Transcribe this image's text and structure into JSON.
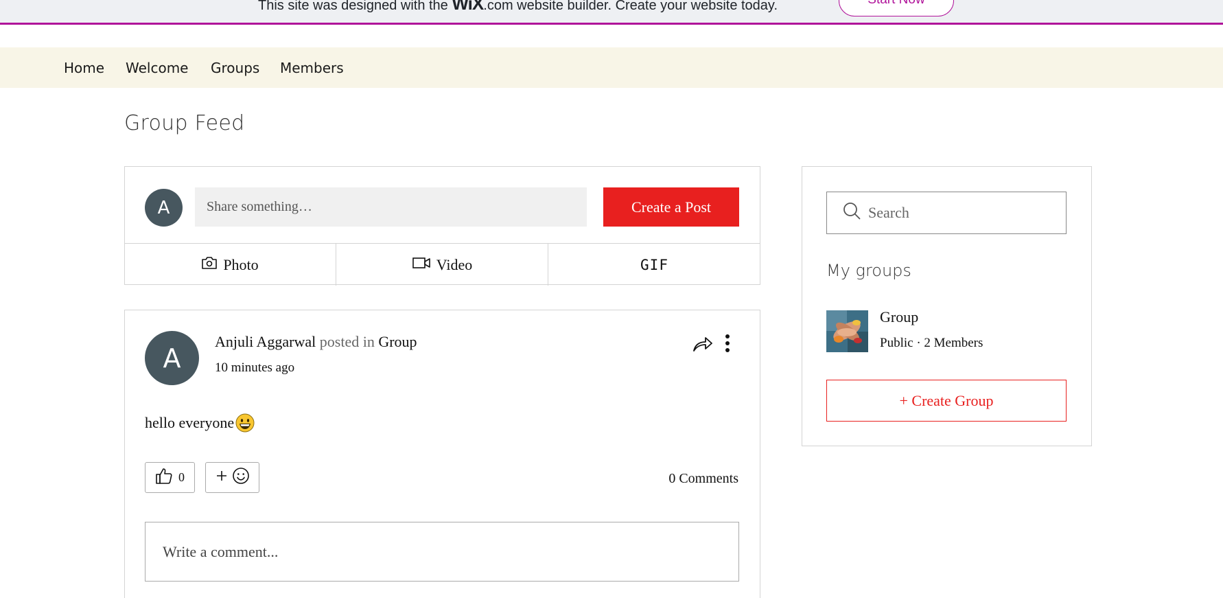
{
  "banner": {
    "text_before": "This site was designed with the",
    "logo": "WiX",
    "text_after": ".com website builder. Create your website today.",
    "button_label": "Start Now"
  },
  "nav": {
    "items": [
      {
        "label": "Home"
      },
      {
        "label": "Welcome"
      },
      {
        "label": "Groups"
      },
      {
        "label": "Members"
      }
    ]
  },
  "page": {
    "title": "Group Feed"
  },
  "composer": {
    "avatar_initial": "A",
    "placeholder": "Share something…",
    "create_label": "Create a Post",
    "photo_label": "Photo",
    "video_label": "Video",
    "gif_label": "GIF"
  },
  "post": {
    "avatar_initial": "A",
    "author": "Anjuli Aggarwal",
    "posted_in": "posted in",
    "group": "Group",
    "time": "10 minutes ago",
    "body": "hello everyone",
    "likes": "0",
    "comments": "0 Comments",
    "comment_placeholder": "Write a comment..."
  },
  "sidebar": {
    "search_placeholder": "Search",
    "my_groups_title": "My groups",
    "groups": [
      {
        "name": "Group",
        "visibility": "Public",
        "separator": "·",
        "members": "2 Members"
      }
    ],
    "create_group_label": "+ Create Group"
  },
  "colors": {
    "accent": "#e8201f",
    "wix_brand": "#b0149a",
    "nav_bg": "#f8f5e7",
    "avatar_bg": "#47575f"
  }
}
